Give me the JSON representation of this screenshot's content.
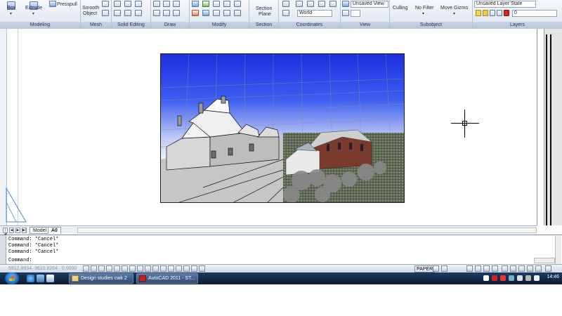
{
  "ribbon": {
    "groups": [
      {
        "title": "Modeling",
        "buttons": [
          "Box",
          "Extrude",
          "Presspull"
        ]
      },
      {
        "title": "Mesh",
        "buttons": [
          "Smooth",
          "Object"
        ]
      },
      {
        "title": "Solid Editing"
      },
      {
        "title": "Draw"
      },
      {
        "title": "Modify"
      },
      {
        "title": "Section",
        "buttons": [
          "Section",
          "Plane"
        ]
      },
      {
        "title": "Coordinates",
        "combo": "World"
      },
      {
        "title": "View",
        "combo": "Unsaved View"
      },
      {
        "title": "Subobject",
        "buttons": [
          "Culling",
          "No Filter",
          "Move Gizmo"
        ]
      },
      {
        "title": "Layers",
        "combo": "Unsaved Layer State",
        "layer": "0"
      }
    ]
  },
  "tabs": {
    "model": "Model",
    "layout": "A0"
  },
  "command": {
    "lines": [
      "Command: *Cancel*",
      "Command: *Cancel*",
      "Command: *Cancel*",
      "Command:"
    ]
  },
  "status": {
    "coords": "5912.8934, 3610.8264 , 0.0000",
    "paper": "PAPER"
  },
  "taskbar": {
    "windows": [
      "Design studies cwk 2",
      "AutoCAD 2011 - ST..."
    ],
    "clock": "14:46"
  },
  "colors": {
    "ribbon_accent": "#b7c6d9",
    "taskbar": "#0c1c31",
    "sky_top": "#1f2ee0"
  }
}
